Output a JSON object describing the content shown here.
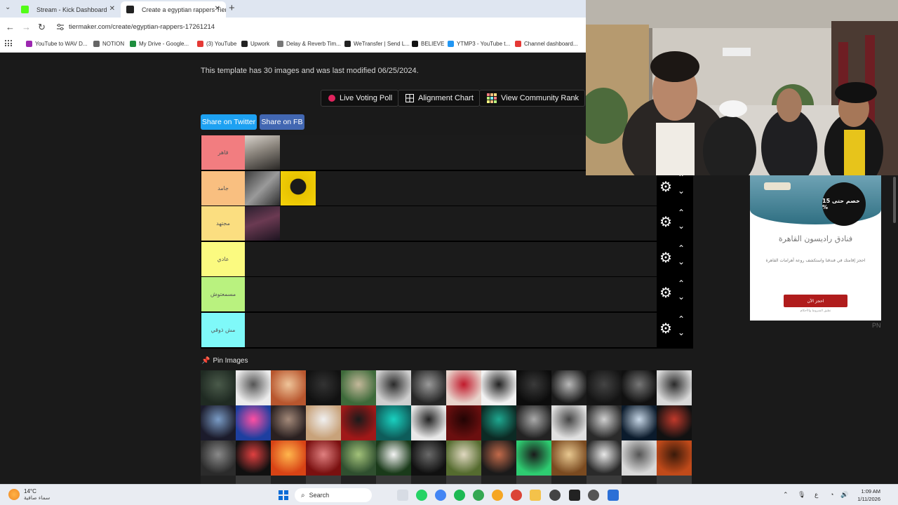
{
  "browser": {
    "tabs": [
      {
        "title": "Stream - Kick Dashboard",
        "close": "✕"
      },
      {
        "title": "Create a egyptian rappers Tier",
        "close": "✕"
      }
    ],
    "new_tab": "+",
    "url": "tiermaker.com/create/egyptian-rappers-17261214",
    "bookmarks": [
      "YouTube to WAV D...",
      "NOTION",
      "My Drive - Google...",
      "(3) YouTube",
      "Upwork",
      "Delay & Reverb Tim...",
      "WeTransfer | Send L...",
      "BELIEVE",
      "YTMP3 - YouTube t...",
      "Channel dashboard..."
    ],
    "bookmark_colors": [
      "#9c27b0",
      "#666666",
      "#1e8e3e",
      "#e53935",
      "#222222",
      "#777777",
      "#222222",
      "#111111",
      "#2196f3",
      "#e53935"
    ]
  },
  "page": {
    "template_info": "This template has 30 images and was last modified 06/25/2024.",
    "buttons": {
      "live_voting": "Live Voting Poll",
      "alignment": "Alignment Chart",
      "community": "View Community Rank"
    },
    "share": {
      "twitter": "Share on Twitter",
      "fb": "Share on FB"
    },
    "tiers": [
      {
        "label": "قاهر",
        "color": "#f27d80"
      },
      {
        "label": "جامد",
        "color": "#f9bf80"
      },
      {
        "label": "مجتهد",
        "color": "#fbde80"
      },
      {
        "label": "عادي",
        "color": "#fbfa80"
      },
      {
        "label": "مسمعتوش",
        "color": "#b9f27f"
      },
      {
        "label": "مش ذوقي",
        "color": "#7ff9f9"
      }
    ],
    "tier_controls": {
      "settings_icon": "gear-icon",
      "up_icon": "chevron-up-icon",
      "down_icon": "chevron-down-icon"
    },
    "pin_images": "Pin Images"
  },
  "ad": {
    "badge": "خصم حتى 15 %",
    "title": "فنادق راديسون القاهرة",
    "text": "احجز إقامتك في فندقنا واستكشف روعة أهرامات القاهرة",
    "button": "احجز الآن",
    "terms": "تطبق الشروط والأحكام",
    "mark": "PN"
  },
  "taskbar": {
    "temp": "14°C",
    "weather": "سماء صافية",
    "search": "Search",
    "lang": "ع",
    "time": "1:09 AM",
    "date": "1/11/2026"
  }
}
